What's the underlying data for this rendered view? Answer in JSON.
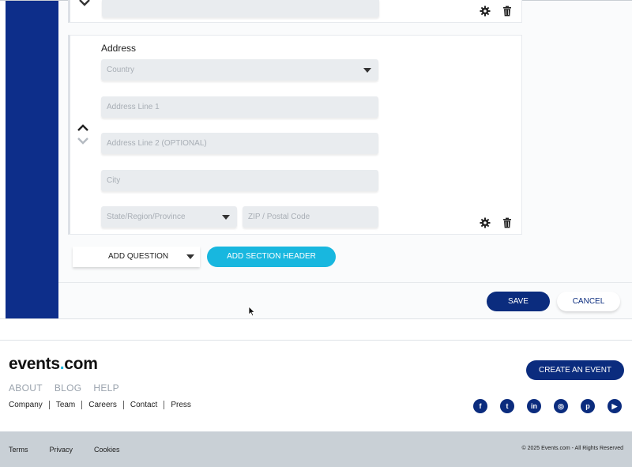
{
  "form": {
    "address_card": {
      "title": "Address",
      "country_placeholder": "Country",
      "address1_placeholder": "Address Line 1",
      "address2_placeholder": "Address Line 2 (OPTIONAL)",
      "city_placeholder": "City",
      "state_placeholder": "State/Region/Province",
      "zip_placeholder": "ZIP / Postal Code"
    },
    "add_question_label": "ADD QUESTION",
    "add_section_label": "ADD SECTION HEADER",
    "save_label": "SAVE",
    "cancel_label": "CANCEL"
  },
  "footer": {
    "logo_main": "events",
    "logo_dot": ".",
    "logo_tail": "com",
    "create_event_label": "CREATE AN EVENT",
    "main_links": [
      "ABOUT",
      "BLOG",
      "HELP"
    ],
    "sub_links": [
      "Company",
      "Team",
      "Careers",
      "Contact",
      "Press"
    ],
    "socials": [
      {
        "icon": "facebook-icon",
        "glyph": "f"
      },
      {
        "icon": "twitter-icon",
        "glyph": "t"
      },
      {
        "icon": "linkedin-icon",
        "glyph": "in"
      },
      {
        "icon": "instagram-icon",
        "glyph": "◎"
      },
      {
        "icon": "pinterest-icon",
        "glyph": "p"
      },
      {
        "icon": "youtube-icon",
        "glyph": "▶"
      }
    ],
    "legal_links": [
      "Terms",
      "Privacy",
      "Cookies"
    ],
    "copyright": "© 2025 Events.com - All Rights Reserved"
  },
  "colors": {
    "brand_navy": "#0b2c7e",
    "accent_cyan": "#18b7df",
    "sidebar": "#0d2e8a"
  }
}
